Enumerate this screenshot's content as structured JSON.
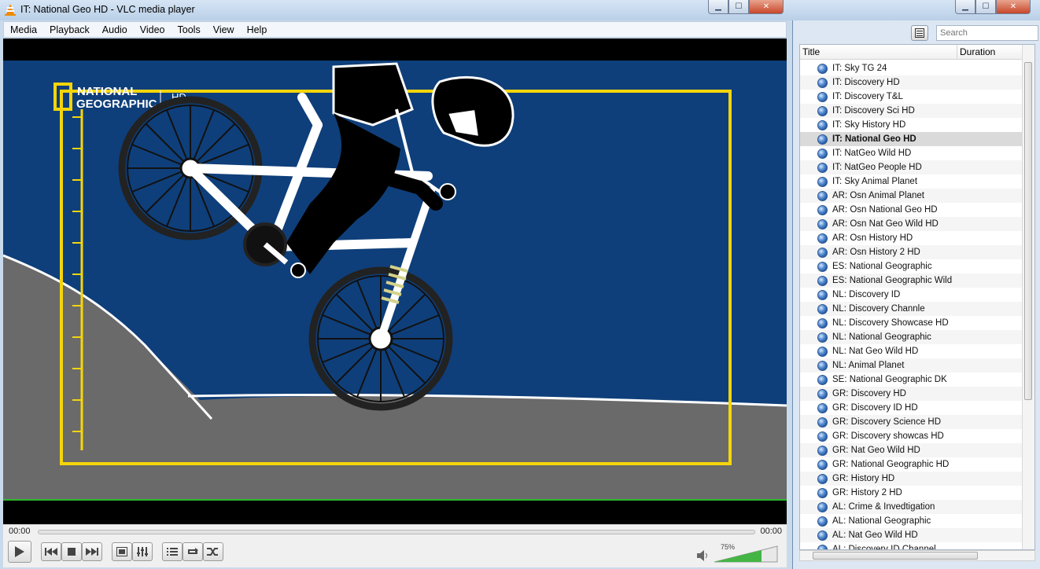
{
  "window": {
    "title": "IT: National Geo HD - VLC media player"
  },
  "menu": [
    "Media",
    "Playback",
    "Audio",
    "Video",
    "Tools",
    "View",
    "Help"
  ],
  "video": {
    "logo_line1": "NATIONAL",
    "logo_line2": "GEOGRAPHIC",
    "logo_hd": "HD"
  },
  "controls": {
    "elapsed": "00:00",
    "total": "00:00",
    "volume_label": "75%",
    "volume_level": 0.75
  },
  "playlist": {
    "search_placeholder": "Search",
    "col_title": "Title",
    "col_duration": "Duration",
    "items": [
      "IT: Sky TG 24",
      "IT: Discovery HD",
      "IT: Discovery T&L",
      "IT: Discovery Sci HD",
      "IT: Sky History HD",
      "IT: National Geo HD",
      "IT: NatGeo Wild HD",
      "IT: NatGeo People HD",
      "IT: Sky Animal Planet",
      "AR: Osn Animal Planet",
      "AR: Osn National Geo HD",
      "AR: Osn Nat Geo Wild HD",
      "AR: Osn History HD",
      "AR: Osn History 2 HD",
      "ES: National Geographic",
      "ES: National Geographic Wild",
      "NL: Discovery ID",
      "NL: Discovery Channle",
      "NL: Discovery Showcase HD",
      "NL: National Geographic",
      "NL: Nat Geo Wild HD",
      "NL: Animal Planet",
      "SE: National Geographic DK",
      "GR: Discovery HD",
      "GR: Discovery ID HD",
      "GR: Discovery Science HD",
      "GR: Discovery showcas HD",
      "GR: Nat Geo Wild HD",
      "GR: National Geographic HD",
      "GR: History HD",
      "GR: History 2 HD",
      "AL: Crime & Invedtigation",
      "AL: National Geographic",
      "AL: Nat Geo Wild HD",
      "AL: Discovery ID Channel"
    ],
    "active_index": 5
  },
  "colors": {
    "video_bg": "#0f3f7a",
    "logo_yellow": "#f5d50a",
    "ground": "#6a6a6a",
    "seek_green": "#2db82d"
  }
}
